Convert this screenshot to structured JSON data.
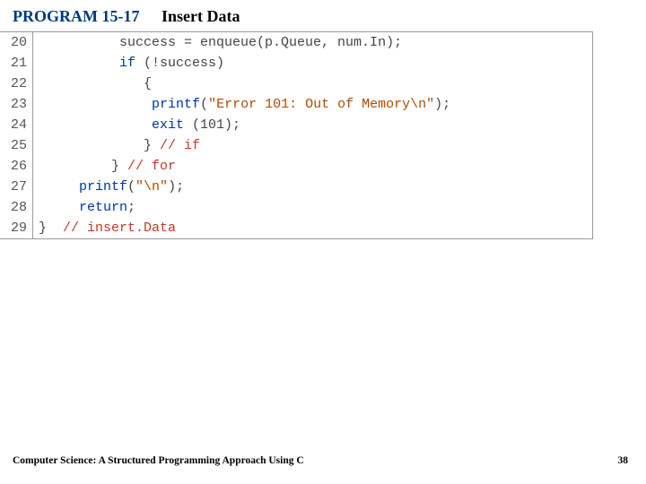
{
  "header": {
    "program": "PROGRAM 15-17",
    "title": "Insert Data"
  },
  "code": {
    "lines": [
      {
        "n": "20",
        "i": "          ",
        "tokens": [
          {
            "t": "success = enqueue(p.Queue, num.In);",
            "c": "pl"
          }
        ]
      },
      {
        "n": "21",
        "i": "          ",
        "tokens": [
          {
            "t": "if",
            "c": "kw"
          },
          {
            "t": " (!success)",
            "c": "pl"
          }
        ]
      },
      {
        "n": "22",
        "i": "             ",
        "tokens": [
          {
            "t": "{",
            "c": "pl"
          }
        ]
      },
      {
        "n": "23",
        "i": "              ",
        "tokens": [
          {
            "t": "printf",
            "c": "kw"
          },
          {
            "t": "(",
            "c": "pl"
          },
          {
            "t": "\"Error 101: Out of Memory\\n\"",
            "c": "st"
          },
          {
            "t": ");",
            "c": "pl"
          }
        ]
      },
      {
        "n": "24",
        "i": "              ",
        "tokens": [
          {
            "t": "exit",
            "c": "kw"
          },
          {
            "t": " (101);",
            "c": "pl"
          }
        ]
      },
      {
        "n": "25",
        "i": "             ",
        "tokens": [
          {
            "t": "} ",
            "c": "pl"
          },
          {
            "t": "// if",
            "c": "cm"
          }
        ]
      },
      {
        "n": "26",
        "i": "         ",
        "tokens": [
          {
            "t": "} ",
            "c": "pl"
          },
          {
            "t": "// for",
            "c": "cm"
          }
        ]
      },
      {
        "n": "27",
        "i": "     ",
        "tokens": [
          {
            "t": "printf",
            "c": "kw"
          },
          {
            "t": "(",
            "c": "pl"
          },
          {
            "t": "\"\\n\"",
            "c": "st"
          },
          {
            "t": ");",
            "c": "pl"
          }
        ]
      },
      {
        "n": "28",
        "i": "     ",
        "tokens": [
          {
            "t": "return",
            "c": "kw"
          },
          {
            "t": ";",
            "c": "pl"
          }
        ]
      },
      {
        "n": "29",
        "i": "",
        "tokens": [
          {
            "t": "}  ",
            "c": "pl"
          },
          {
            "t": "// insert.Data",
            "c": "cm"
          }
        ]
      }
    ]
  },
  "footer": {
    "book": "Computer Science: A Structured Programming Approach Using C",
    "page": "38"
  }
}
